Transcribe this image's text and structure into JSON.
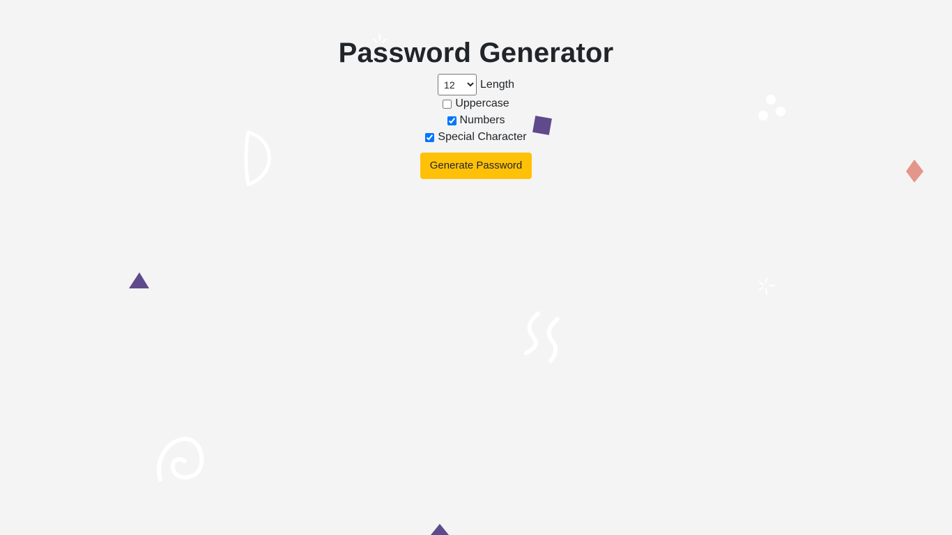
{
  "page": {
    "title": "Password Generator"
  },
  "form": {
    "length": {
      "selected": "12",
      "label": "Length"
    },
    "options": [
      {
        "label": "Uppercase",
        "checked": false
      },
      {
        "label": "Numbers",
        "checked": true
      },
      {
        "label": "Special Character",
        "checked": true
      }
    ],
    "generate_button_label": "Generate Password"
  },
  "colors": {
    "background": "#f4f4f4",
    "button": "#ffc107",
    "purple_shape": "#5f4a8b",
    "pink_shape": "#e5968a",
    "white_doodle": "#ffffff"
  }
}
